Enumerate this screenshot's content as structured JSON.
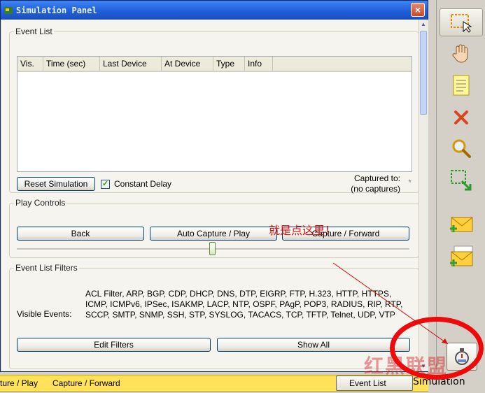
{
  "window": {
    "title": "Simulation Panel",
    "close_label": "×"
  },
  "event_list": {
    "legend": "Event List",
    "columns": [
      "Vis.",
      "Time (sec)",
      "Last Device",
      "At Device",
      "Type",
      "Info"
    ],
    "reset_label": "Reset Simulation",
    "constant_delay_label": "Constant Delay",
    "constant_delay_checked": true,
    "captured_label": "Captured to:",
    "captured_value": "(no captures)",
    "captured_star": "*"
  },
  "play_controls": {
    "legend": "Play Controls",
    "back_label": "Back",
    "auto_label": "Auto Capture / Play",
    "forward_label": "Capture / Forward",
    "speed_slider_value": 0.5
  },
  "annotation": "就是点这里！",
  "filters": {
    "legend": "Event List Filters",
    "visible_label": "Visible Events:",
    "visible_events": "ACL Filter, ARP, BGP, CDP, DHCP, DNS, DTP, EIGRP, FTP, H.323, HTTP, HTTPS, ICMP, ICMPv6, IPSec, ISAKMP, LACP, NTP, OSPF, PAgP, POP3, RADIUS, RIP, RTP, SCCP, SMTP, SNMP, SSH, STP, SYSLOG, TACACS, TCP, TFTP, Telnet, UDP, VTP",
    "edit_label": "Edit Filters",
    "show_all_label": "Show All"
  },
  "status_bar": {
    "left_text": "ture / Play",
    "right_text": "Capture / Forward",
    "event_list_tab": "Event List"
  },
  "toolbar": {
    "tools": [
      "select-icon",
      "hand-icon",
      "note-icon",
      "delete-icon",
      "zoom-icon",
      "resize-icon",
      "add-simple-pdu-icon",
      "add-complex-pdu-icon"
    ],
    "simulation_label": "Simulation"
  },
  "watermark": "红黑联盟",
  "colors": {
    "accent": "#1f5fd9",
    "status_bar": "#ffe25a",
    "annotation": "#d31212"
  }
}
